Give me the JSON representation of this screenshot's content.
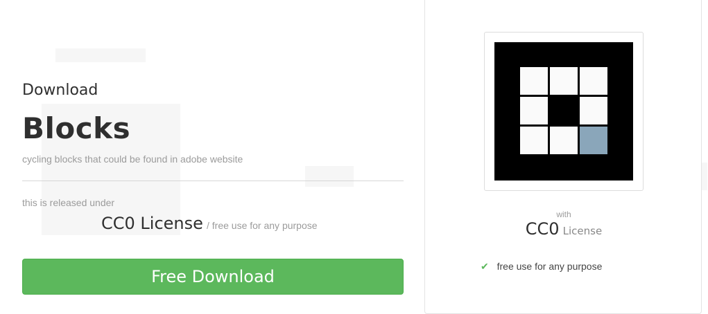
{
  "hero": {
    "kicker": "Download",
    "title": "Blocks",
    "description": "cycling blocks that could be found in adobe website",
    "released_text": "this is released under",
    "license_name": "CC0 License",
    "license_suffix": "/ free use for any purpose",
    "download_label": "Free Download"
  },
  "card": {
    "with_text": "with",
    "license_primary": "CC0",
    "license_secondary": "License",
    "feature_text": "free use for any purpose",
    "feature_icon": "check-icon"
  },
  "preview": {
    "frame_color": "#000000",
    "cells": [
      {
        "color": "#fafafa"
      },
      {
        "color": "#fafafa"
      },
      {
        "color": "#fafafa"
      },
      {
        "color": "#fafafa"
      },
      {
        "color": "#000000"
      },
      {
        "color": "#fafafa"
      },
      {
        "color": "#fafafa"
      },
      {
        "color": "#fafafa"
      },
      {
        "color": "#8aa6ba"
      }
    ]
  },
  "colors": {
    "primary_button": "#5cb85c",
    "check": "#5cb85c"
  }
}
